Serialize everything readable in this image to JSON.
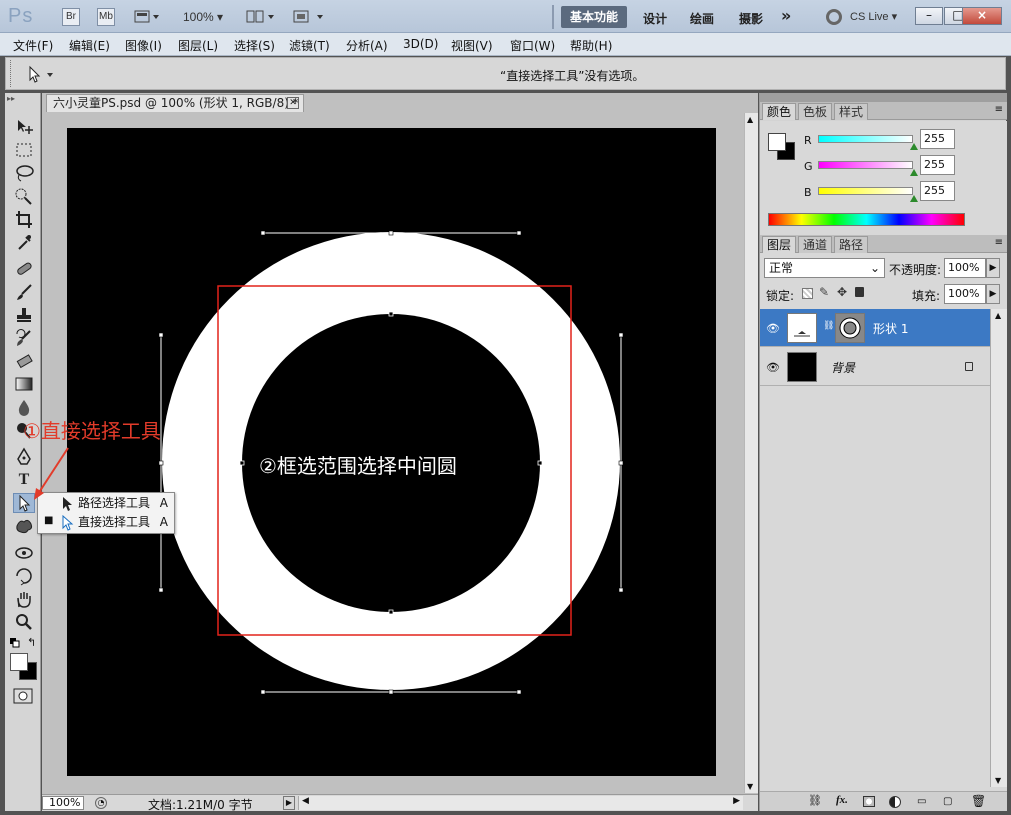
{
  "app": {
    "logo": "Ps",
    "title_buttons": [
      "Br",
      "Mb"
    ],
    "zoom": "100%",
    "workspaces": {
      "active": "基本功能",
      "items": [
        "设计",
        "绘画",
        "摄影"
      ],
      "more": "»"
    },
    "cs_live": "CS Live",
    "window_controls": [
      "–",
      "□",
      "×"
    ]
  },
  "menu": [
    "文件(F)",
    "编辑(E)",
    "图像(I)",
    "图层(L)",
    "选择(S)",
    "滤镜(T)",
    "分析(A)",
    "3D(D)",
    "视图(V)",
    "窗口(W)",
    "帮助(H)"
  ],
  "options": {
    "message": "“直接选择工具”没有选项。"
  },
  "document": {
    "tab_title": "六小灵童PS.psd @ 100% (形状 1, RGB/8) *",
    "zoom": "100%",
    "doc_info": "文档:1.21M/0 字节"
  },
  "flyout": {
    "items": [
      {
        "label": "路径选择工具",
        "key": "A",
        "active": false
      },
      {
        "label": "直接选择工具",
        "key": "A",
        "active": true
      }
    ]
  },
  "annotations": {
    "step1": "①直接选择工具",
    "step2": "②框选范围选择中间圆"
  },
  "color_panel": {
    "tabs": [
      "颜色",
      "色板",
      "样式"
    ],
    "r_label": "R",
    "g_label": "G",
    "b_label": "B",
    "r": "255",
    "g": "255",
    "b": "255",
    "foreground": "#ffffff",
    "background": "#000000"
  },
  "layers_panel": {
    "tabs": [
      "图层",
      "通道",
      "路径"
    ],
    "blend_mode": "正常",
    "opacity_label": "不透明度:",
    "opacity": "100%",
    "lock_label": "锁定:",
    "fill_label": "填充:",
    "fill": "100%",
    "layers": [
      {
        "name": "形状 1",
        "selected": true
      },
      {
        "name": "背景",
        "selected": false
      }
    ],
    "footer_icons": [
      "link-icon",
      "fx-icon",
      "mask-icon",
      "adjustment-icon",
      "folder-icon",
      "new-layer-icon",
      "trash-icon"
    ],
    "fx_label": "fx."
  },
  "colors": {
    "accent_selection": "#3c79c4",
    "annotation_red": "#e23b2a",
    "marquee_red": "#e2231a"
  }
}
